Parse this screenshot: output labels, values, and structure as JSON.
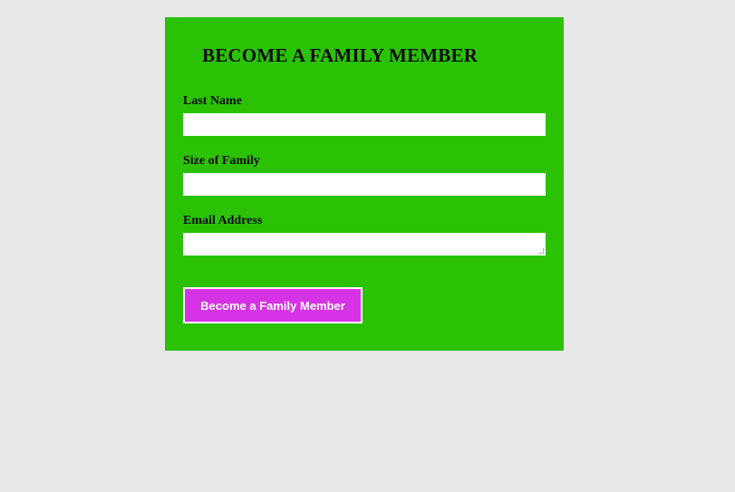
{
  "form": {
    "title": "BECOME A FAMILY MEMBER",
    "fields": [
      {
        "label": "Last Name",
        "value": "",
        "placeholder": ""
      },
      {
        "label": "Size of Family",
        "value": "",
        "placeholder": ""
      },
      {
        "label": "Email Address",
        "value": "",
        "placeholder": ""
      }
    ],
    "submit_label": "Become a Family Member"
  },
  "colors": {
    "page_background": "#e8e8e8",
    "panel_background": "#2bc205",
    "button_background": "#d633e6",
    "button_text": "#ffffff",
    "input_background": "#ffffff"
  }
}
